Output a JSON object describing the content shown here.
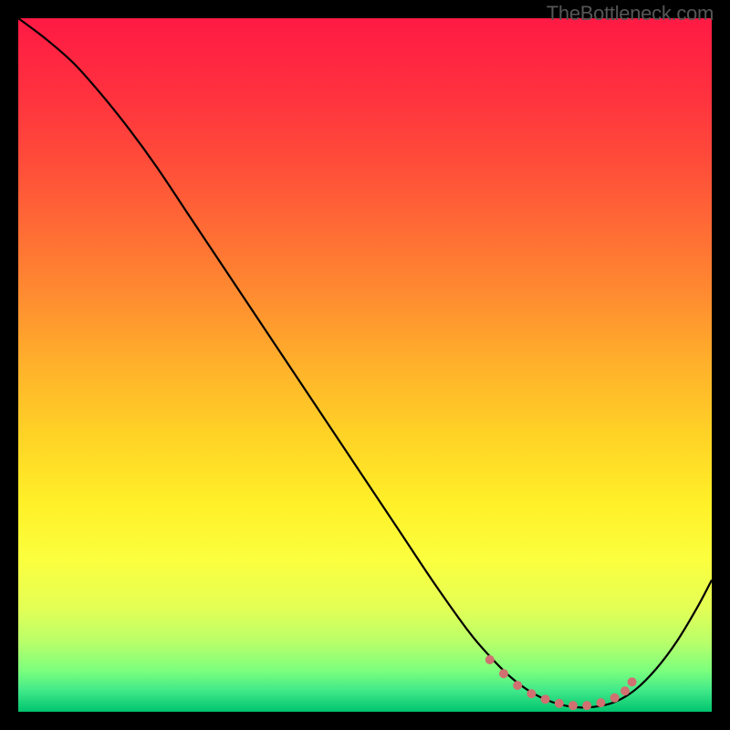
{
  "watermark": "TheBottleneck.com",
  "chart_data": {
    "type": "line",
    "title": "",
    "xlabel": "",
    "ylabel": "",
    "xlim": [
      0,
      100
    ],
    "ylim": [
      0,
      100
    ],
    "background_gradient": {
      "stops": [
        {
          "offset": 0.0,
          "color": "#ff1a44"
        },
        {
          "offset": 0.1,
          "color": "#ff2f3f"
        },
        {
          "offset": 0.2,
          "color": "#ff4a3a"
        },
        {
          "offset": 0.3,
          "color": "#ff6a35"
        },
        {
          "offset": 0.4,
          "color": "#ff8c30"
        },
        {
          "offset": 0.5,
          "color": "#ffb12b"
        },
        {
          "offset": 0.6,
          "color": "#ffd226"
        },
        {
          "offset": 0.7,
          "color": "#fff028"
        },
        {
          "offset": 0.78,
          "color": "#fbff3e"
        },
        {
          "offset": 0.85,
          "color": "#e4ff55"
        },
        {
          "offset": 0.9,
          "color": "#b8ff6a"
        },
        {
          "offset": 0.94,
          "color": "#7dff7d"
        },
        {
          "offset": 0.97,
          "color": "#40e889"
        },
        {
          "offset": 1.0,
          "color": "#00c46e"
        }
      ]
    },
    "series": [
      {
        "name": "bottleneck-curve",
        "color": "#000000",
        "x": [
          0,
          4,
          8,
          12,
          16,
          20,
          25,
          30,
          35,
          40,
          45,
          50,
          55,
          60,
          65,
          68,
          71,
          74,
          77,
          80,
          83,
          86,
          89,
          92,
          95,
          98,
          100
        ],
        "y": [
          100,
          97,
          93.5,
          89,
          84,
          78.5,
          71,
          63.5,
          56,
          48.5,
          41,
          33.5,
          26,
          18.5,
          11.5,
          8,
          5,
          2.8,
          1.4,
          0.7,
          0.7,
          1.4,
          3.2,
          6.2,
          10.2,
          15.2,
          19
        ]
      }
    ],
    "markers": {
      "name": "optimal-range-dots",
      "color": "#d07070",
      "radius": 5,
      "points": [
        {
          "x": 68,
          "y": 7.5
        },
        {
          "x": 70,
          "y": 5.5
        },
        {
          "x": 72,
          "y": 3.8
        },
        {
          "x": 74,
          "y": 2.6
        },
        {
          "x": 76,
          "y": 1.8
        },
        {
          "x": 78,
          "y": 1.2
        },
        {
          "x": 80,
          "y": 0.9
        },
        {
          "x": 82,
          "y": 0.9
        },
        {
          "x": 84,
          "y": 1.3
        },
        {
          "x": 86,
          "y": 2.0
        },
        {
          "x": 87.5,
          "y": 3.0
        },
        {
          "x": 88.5,
          "y": 4.3
        }
      ]
    }
  }
}
